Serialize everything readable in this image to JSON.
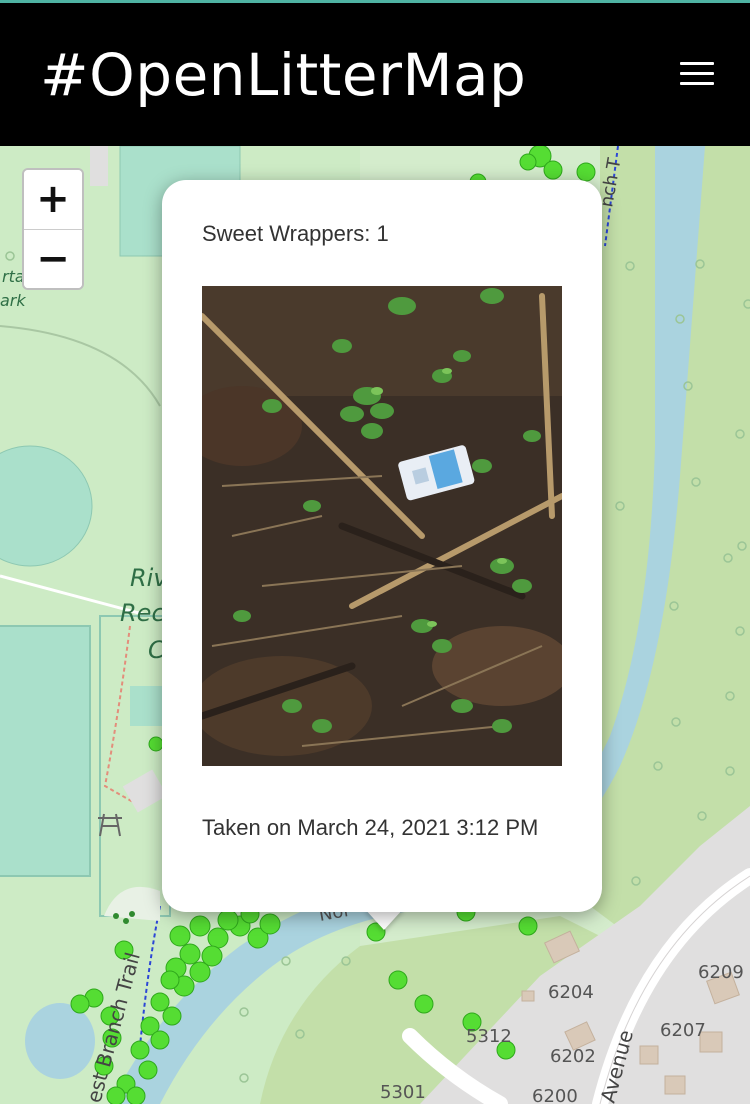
{
  "header": {
    "brand": "#OpenLitterMap",
    "menu_icon": "hamburger-menu-icon"
  },
  "map": {
    "zoom_in_label": "+",
    "zoom_out_label": "−",
    "labels": {
      "park_partial": "rtar",
      "park_partial2": "ark",
      "rec_1": "Riv",
      "rec_2": "Rec",
      "rec_3": "C",
      "trail_name": "est Branch Trail",
      "road_partial": "Nor",
      "branch_partial": "nch T",
      "avenue": "Avenue",
      "house_6209": "6209",
      "house_6204": "6204",
      "house_6207": "6207",
      "house_5312": "5312",
      "house_6202": "6202",
      "house_5301": "5301",
      "house_6200": "6200"
    },
    "colors": {
      "park": "#cdebc5",
      "grass": "#c3dfa9",
      "water": "#aad3df",
      "pitch": "#aae0cb",
      "residential": "#e0dfdf",
      "marker": "#55dd33"
    }
  },
  "popup": {
    "title": "Sweet Wrappers: 1",
    "date": "Taken on March 24, 2021 3:12 PM"
  }
}
